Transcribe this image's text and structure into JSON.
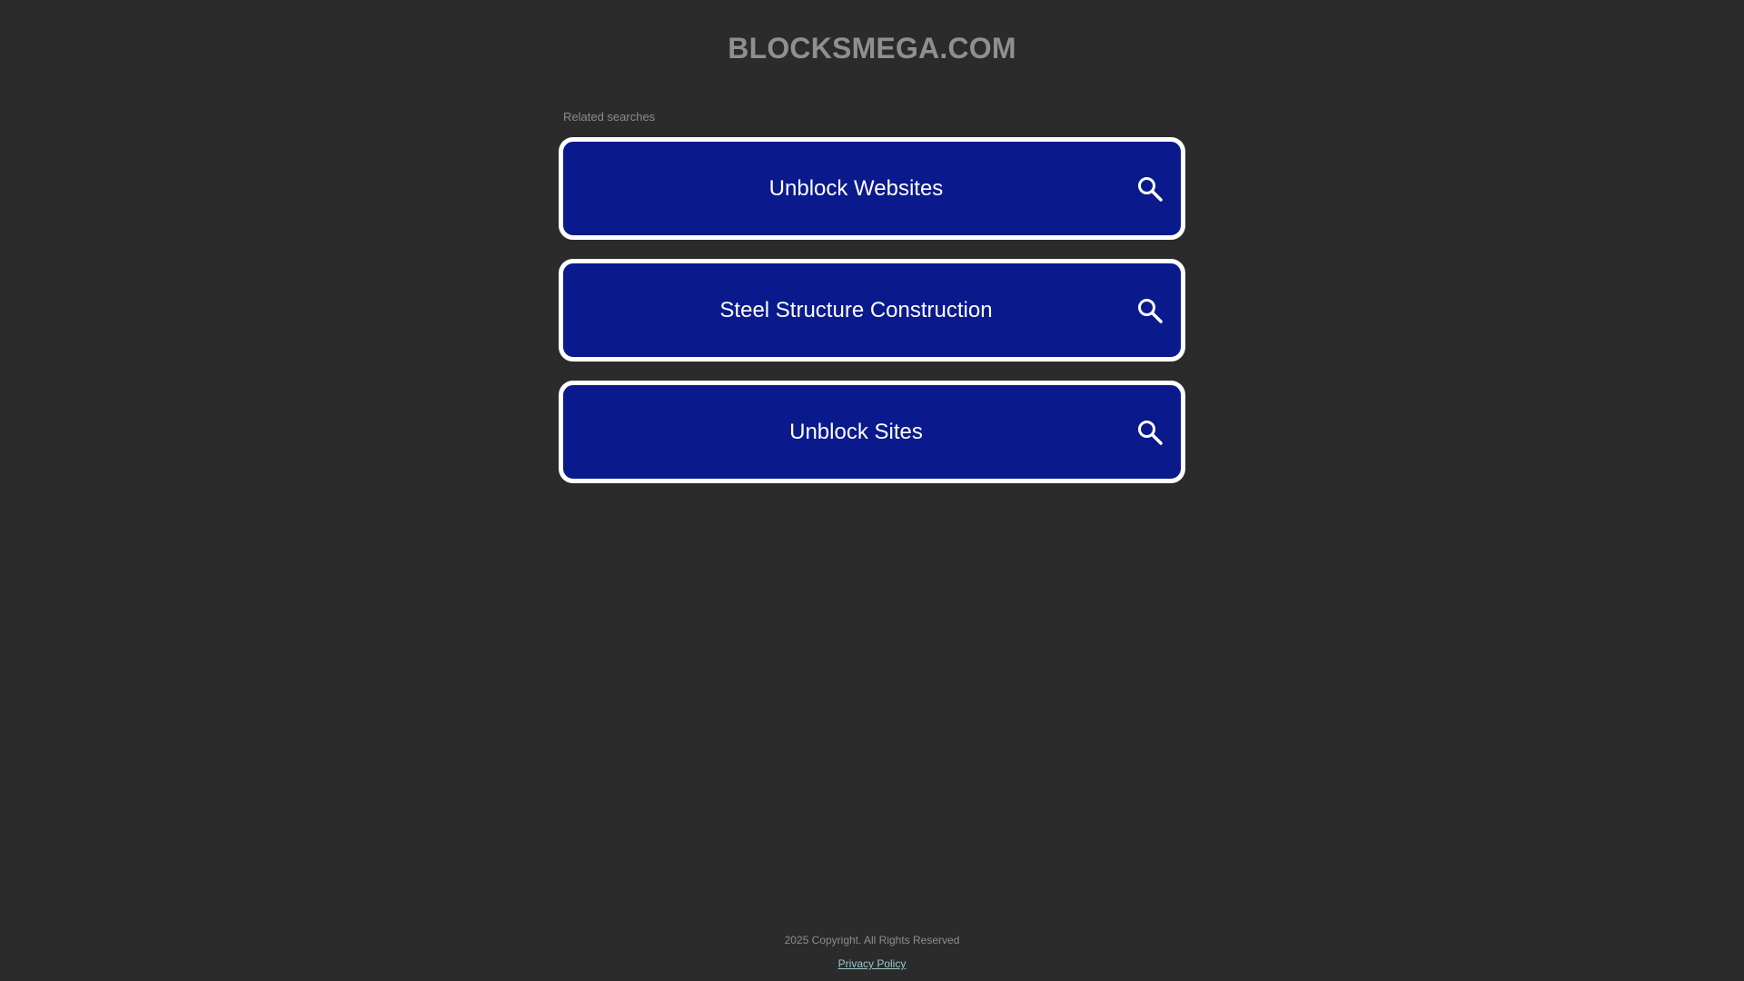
{
  "site": {
    "title": "BLOCKSMEGA.COM"
  },
  "related": {
    "label": "Related searches",
    "items": [
      {
        "label": "Unblock Websites",
        "icon": "search-icon"
      },
      {
        "label": "Steel Structure Construction",
        "icon": "search-icon"
      },
      {
        "label": "Unblock Sites",
        "icon": "search-icon"
      }
    ]
  },
  "footer": {
    "copyright": "2025 Copyright. All Rights Reserved",
    "privacy_label": "Privacy Policy"
  },
  "colors": {
    "background": "#2b2b2b",
    "button_fill": "#0a1a8c",
    "button_border": "#ffffff",
    "title": "#8f8f8f",
    "link": "#9ec4c8"
  }
}
